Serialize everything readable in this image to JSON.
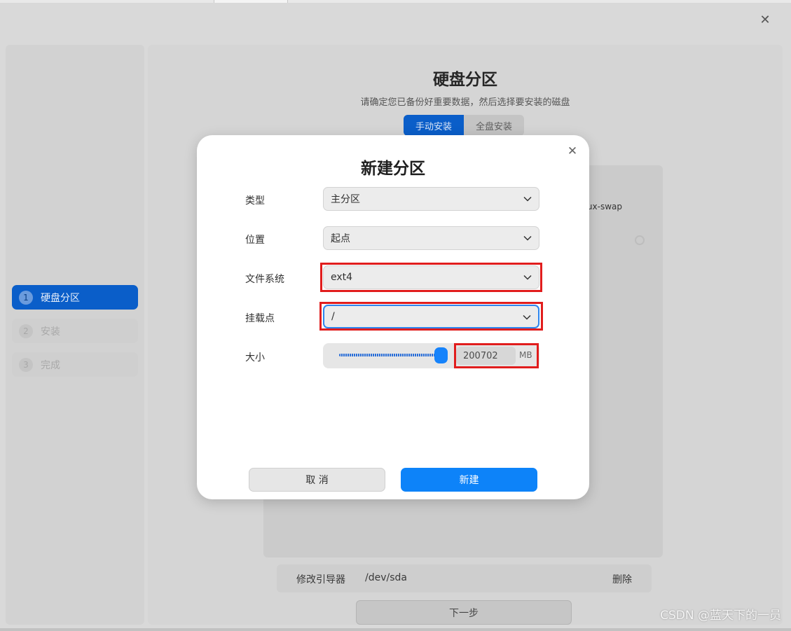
{
  "window": {
    "close_icon": "close-icon"
  },
  "sidebar": {
    "steps": [
      {
        "num": "1",
        "label": "硬盘分区"
      },
      {
        "num": "2",
        "label": "安装"
      },
      {
        "num": "3",
        "label": "完成"
      }
    ]
  },
  "main": {
    "title": "硬盘分区",
    "subtitle": "请确定您已备份好重要数据，然后选择要安装的磁盘",
    "modes": [
      "手动安装",
      "全盘安装"
    ],
    "partition_hint": "nux-swap",
    "boot": {
      "label": "修改引导器",
      "device": "/dev/sda",
      "delete": "删除"
    },
    "next": "下一步"
  },
  "dialog": {
    "title": "新建分区",
    "type_label": "类型",
    "type_value": "主分区",
    "position_label": "位置",
    "position_value": "起点",
    "fs_label": "文件系统",
    "fs_value": "ext4",
    "mount_label": "挂载点",
    "mount_value": "/",
    "size_label": "大小",
    "size_value": "200702",
    "size_unit": "MB",
    "slider_fraction": 1.0,
    "cancel": "取 消",
    "create": "新建"
  },
  "watermark": "CSDN @蓝天下的一员",
  "colors": {
    "accent": "#0d83f9",
    "highlight": "#e11d1d",
    "sidebar_active": "#0a5ec9"
  }
}
